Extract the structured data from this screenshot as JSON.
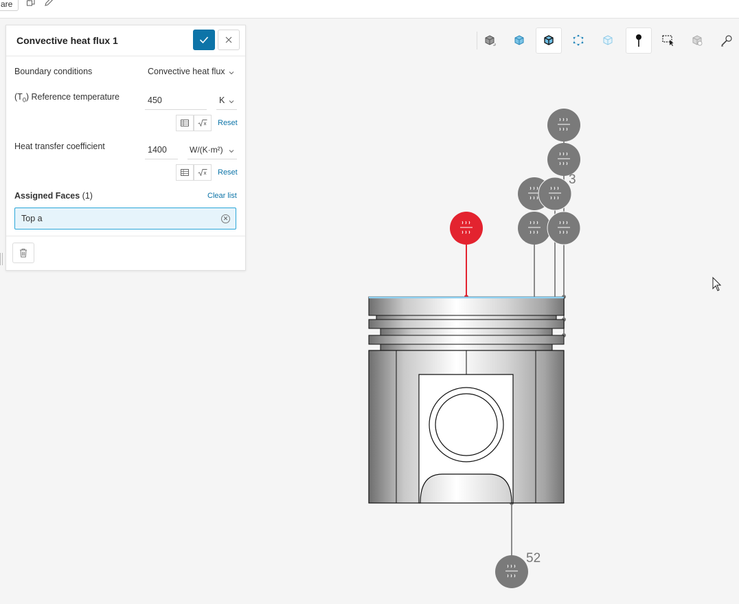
{
  "topbar": {
    "share_label": "are"
  },
  "panel": {
    "title": "Convective heat flux 1",
    "boundary_conditions": {
      "label": "Boundary conditions",
      "value": "Convective heat flux"
    },
    "reference_temperature": {
      "label_pre": "(T",
      "label_sub": "0",
      "label_post": ") Reference temperature",
      "value": "450",
      "unit": "K",
      "reset": "Reset"
    },
    "heat_transfer_coefficient": {
      "label": "Heat transfer coefficient",
      "value": "1400",
      "unit": "W/(K·m²)",
      "reset": "Reset"
    },
    "assigned_faces": {
      "label": "Assigned Faces",
      "count": "(1)",
      "clear": "Clear list",
      "item": "Top a"
    }
  },
  "viewport": {
    "marker_labels": {
      "top_group": "3",
      "bottom": "52"
    },
    "colors": {
      "selected_marker": "#e3232f",
      "marker": "#7a7a7a",
      "selection": "#8fd0f0",
      "accent": "#0d74a8"
    }
  },
  "icons": [
    "check-icon",
    "close-icon",
    "chevron-down-icon",
    "table-icon",
    "sqrt-icon",
    "trash-icon",
    "heat-flux-icon",
    "cursor-icon",
    "cube-icons"
  ]
}
